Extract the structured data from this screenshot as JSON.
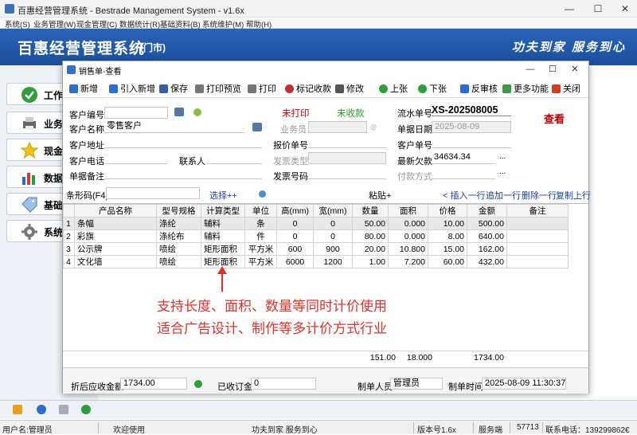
{
  "window": {
    "title": "百惠经营管理系统 - Bestrade Management System - v1.6x",
    "controls": [
      "—",
      "☐",
      "✕"
    ]
  },
  "menu": [
    "系统(S)",
    "业务管理(W)",
    "现金管理(C)",
    "数据统计(R)",
    "基础资料(B)",
    "系统维护(M)",
    "帮助(H)"
  ],
  "banner": {
    "title": "百惠经营管理系统",
    "subtitle": "(门市)",
    "slogan": "功夫到家 服务到心"
  },
  "leftnav": [
    "工作",
    "业务",
    "现金",
    "数据",
    "基础",
    "系统"
  ],
  "dialog": {
    "title": "销售单-查看",
    "toolbar": [
      "新增",
      "引入新增",
      "保存",
      "打印预览",
      "打印",
      "标记收款",
      "修改",
      "上张",
      "下张",
      "反审核",
      "更多功能",
      "关闭"
    ]
  },
  "form": {
    "customer_no_label": "客户编号",
    "customer_no": "",
    "customer_name_label": "客户名称",
    "customer_name": "零售客户",
    "customer_addr_label": "客户地址",
    "customer_addr": "",
    "customer_phone_label": "客户电话",
    "customer_phone": "",
    "contact_label": "联系人",
    "contact": "",
    "note_label": "单据备注",
    "note": "",
    "print_status": "未打印",
    "pay_status": "未收款",
    "salesman_label": "业务员",
    "salesman": "",
    "quote_no_label": "报价单号",
    "quote_no": "",
    "invoice_type_label": "发票类型",
    "invoice_type": "",
    "invoice_no_label": "发票号码",
    "invoice_no": "",
    "serial_label": "流水单号",
    "serial": "XS-202508005",
    "date_label": "单据日期",
    "date": "2025-08-09",
    "cust_order_label": "客户单号",
    "cust_order": "",
    "debt_label": "最新欠款",
    "debt": "34634.34",
    "pay_method_label": "付款方式",
    "pay_method": "",
    "view_label": "查看"
  },
  "barcode": {
    "label": "条形码(F4)",
    "value": "",
    "select": "选择++",
    "paste": "粘贴+",
    "insert": "< 插入一行",
    "append": "追加一行",
    "delete": "删除一行",
    "copy": "复制上行"
  },
  "grid": {
    "headers": [
      "",
      "产品名称",
      "型号规格",
      "计算类型",
      "单位",
      "高(mm)",
      "宽(mm)",
      "数量",
      "面积",
      "价格",
      "金额",
      "备注"
    ],
    "rows": [
      [
        "1",
        "条幅",
        "涤纶",
        "辅料",
        "条",
        "0",
        "0",
        "50.00",
        "0.000",
        "10.00",
        "500.00",
        ""
      ],
      [
        "2",
        "彩旗",
        "涤纶布",
        "辅料",
        "件",
        "0",
        "0",
        "80.00",
        "0.000",
        "8.00",
        "640.00",
        ""
      ],
      [
        "3",
        "公示牌",
        "喷绘",
        "矩形面积",
        "平方米",
        "600",
        "900",
        "20.00",
        "10.800",
        "15.00",
        "162.00",
        ""
      ],
      [
        "4",
        "文化墙",
        "喷绘",
        "矩形面积",
        "平方米",
        "6000",
        "1200",
        "1.00",
        "7.200",
        "60.00",
        "432.00",
        ""
      ]
    ],
    "totals": {
      "qty": "151.00",
      "area": "18.000",
      "amount": "1734.00"
    }
  },
  "annotation": {
    "line1": "支持长度、面积、数量等同时计价使用",
    "line2": "适合广告设计、制作等多计价方式行业",
    "color": "#e0302a"
  },
  "footer": {
    "discount_label": "折后应收金额",
    "discount": "1734.00",
    "deposit_label": "已收订金",
    "deposit": "0",
    "maker_label": "制单人员",
    "maker": "管理员",
    "time_label": "制单时间",
    "time": "2025-08-09 11:30:37"
  },
  "status": {
    "user": "用户名:管理员",
    "welcome": "欢迎使用",
    "slogan": "功夫到家 服务到心",
    "version": "版本号1.6x",
    "server": "服务端",
    "code": "57713",
    "phone": "联系电话：139299862€"
  }
}
